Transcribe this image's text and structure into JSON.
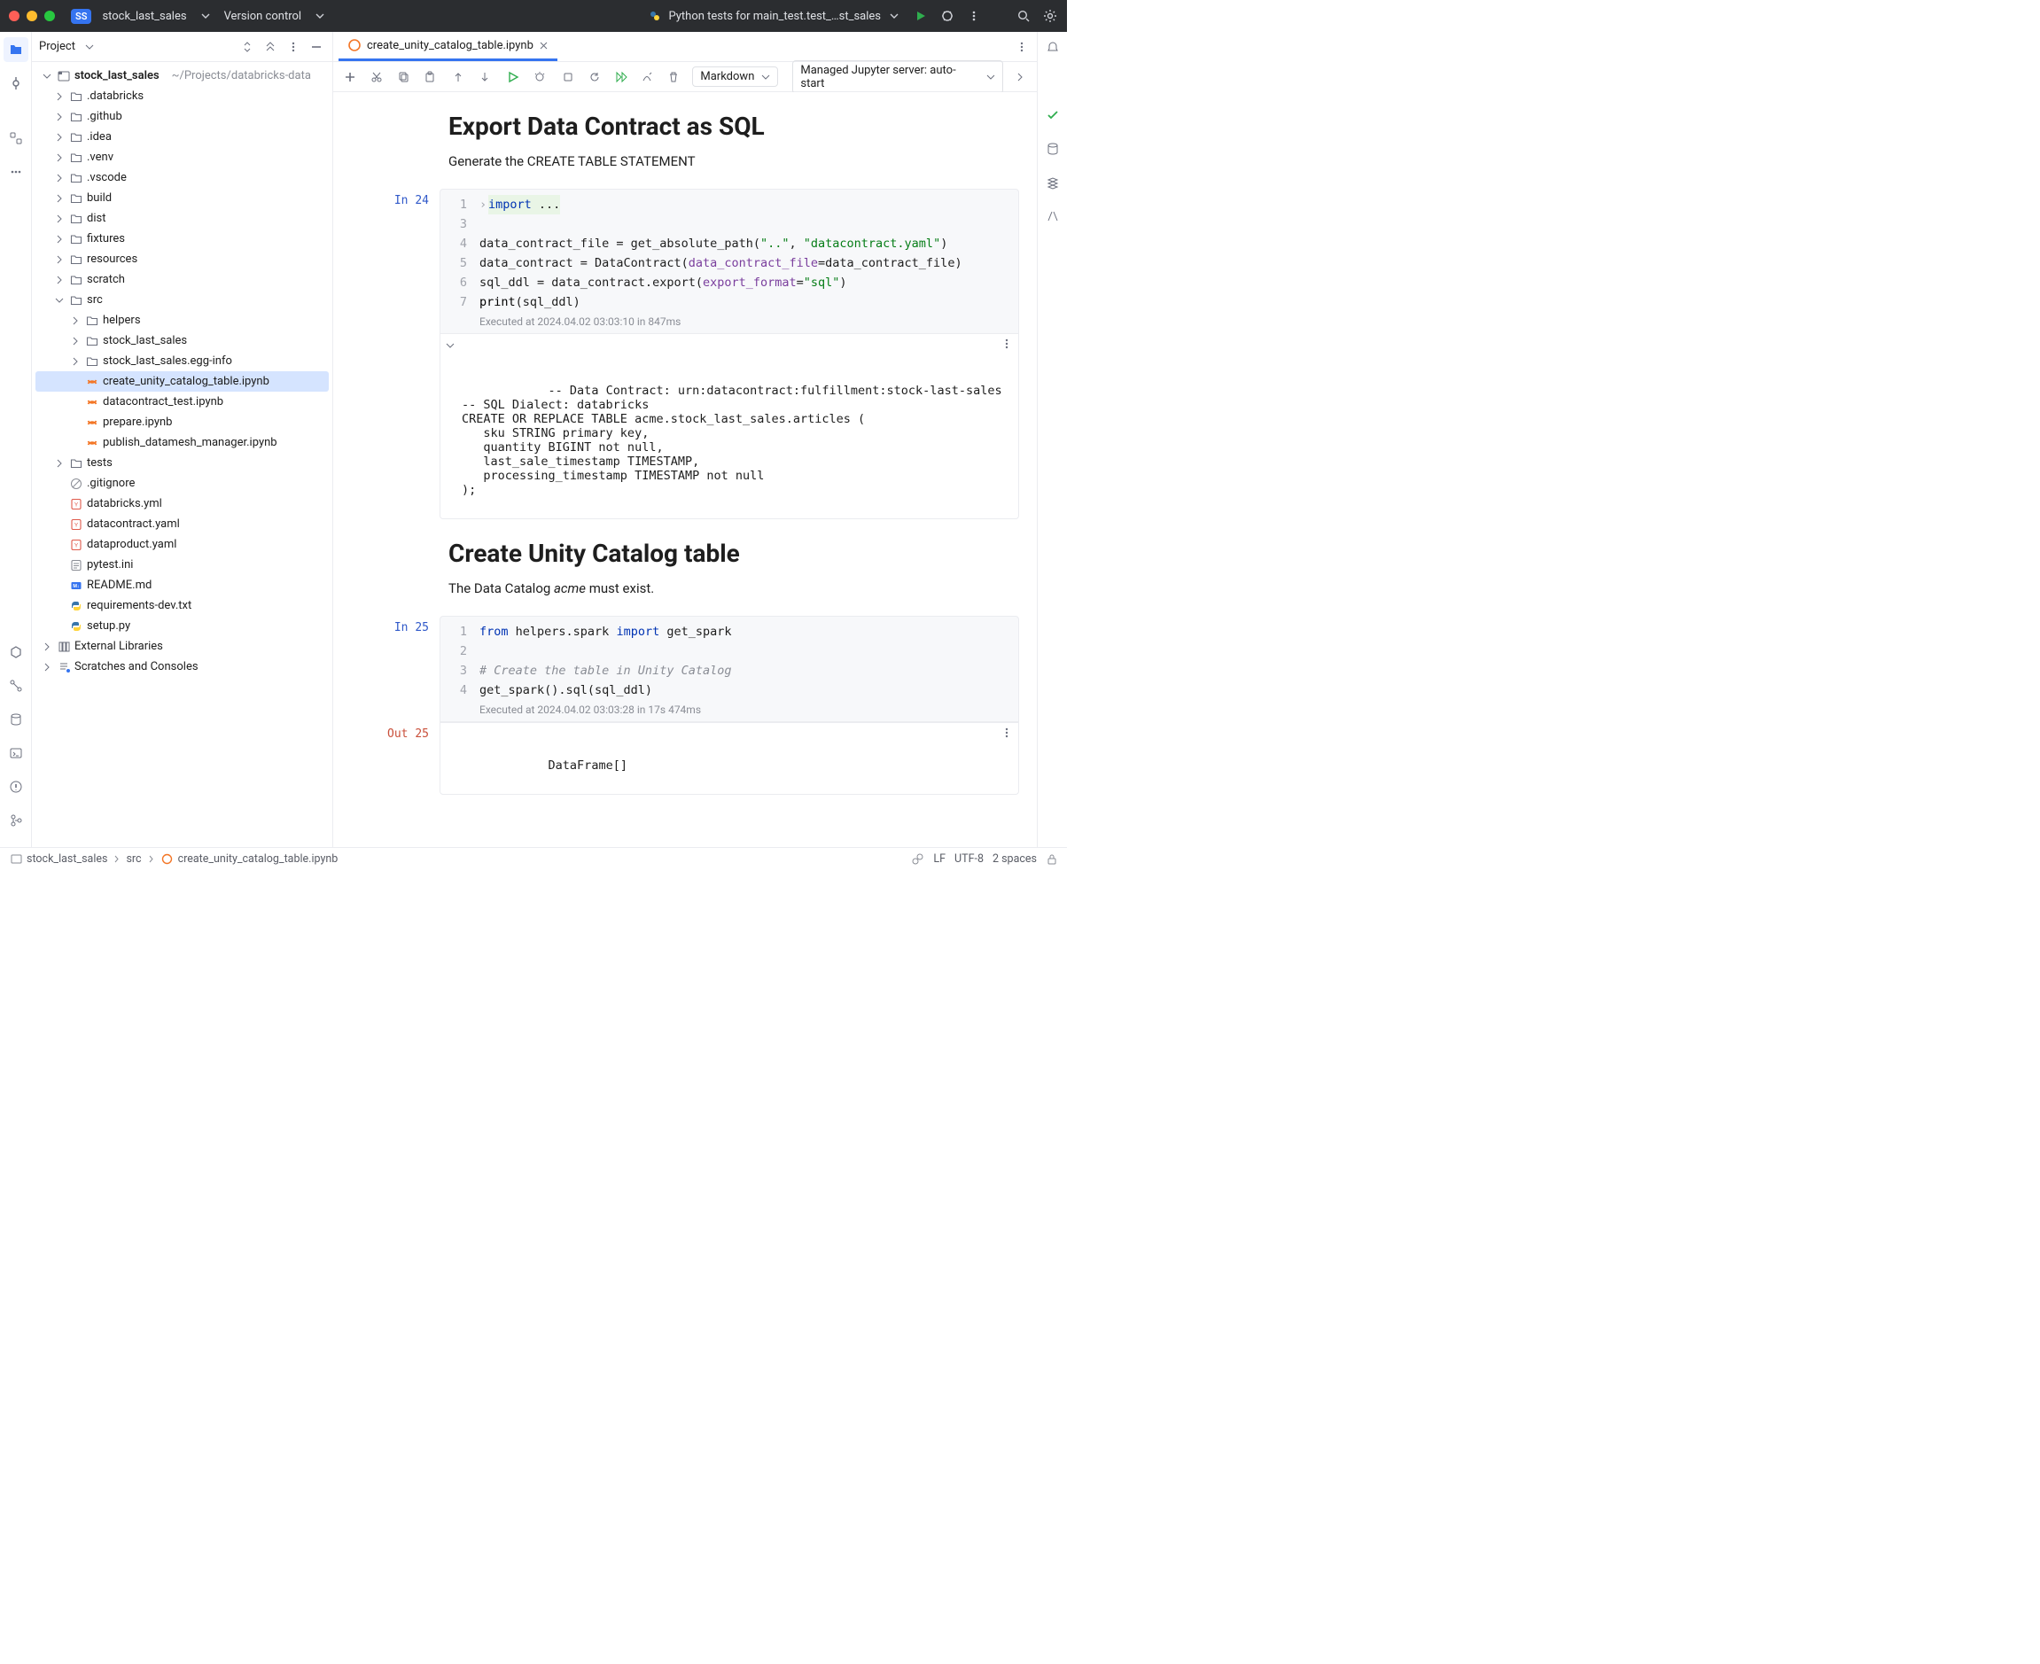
{
  "titlebar": {
    "project_badge": "SS",
    "project_name": "stock_last_sales",
    "version_control": "Version control",
    "run_config": "Python tests for main_test.test_…st_sales"
  },
  "project_panel": {
    "title": "Project"
  },
  "tree": {
    "root_name": "stock_last_sales",
    "root_path": "~/Projects/databricks-data",
    "items": [
      {
        "depth": 0,
        "chev": "right",
        "icon": "folder",
        "label": ".databricks"
      },
      {
        "depth": 0,
        "chev": "right",
        "icon": "folder",
        "label": ".github"
      },
      {
        "depth": 0,
        "chev": "right",
        "icon": "folder",
        "label": ".idea"
      },
      {
        "depth": 0,
        "chev": "right",
        "icon": "folder",
        "label": ".venv"
      },
      {
        "depth": 0,
        "chev": "right",
        "icon": "folder",
        "label": ".vscode"
      },
      {
        "depth": 0,
        "chev": "right",
        "icon": "folder",
        "label": "build"
      },
      {
        "depth": 0,
        "chev": "right",
        "icon": "folder",
        "label": "dist"
      },
      {
        "depth": 0,
        "chev": "right",
        "icon": "folder",
        "label": "fixtures"
      },
      {
        "depth": 0,
        "chev": "right",
        "icon": "folder",
        "label": "resources"
      },
      {
        "depth": 0,
        "chev": "right",
        "icon": "folder",
        "label": "scratch"
      },
      {
        "depth": 0,
        "chev": "down",
        "icon": "folder",
        "label": "src"
      },
      {
        "depth": 1,
        "chev": "right",
        "icon": "folder",
        "label": "helpers"
      },
      {
        "depth": 1,
        "chev": "right",
        "icon": "folder",
        "label": "stock_last_sales"
      },
      {
        "depth": 1,
        "chev": "right",
        "icon": "folder",
        "label": "stock_last_sales.egg-info"
      },
      {
        "depth": 1,
        "chev": "",
        "icon": "jupyter",
        "label": "create_unity_catalog_table.ipynb",
        "selected": true
      },
      {
        "depth": 1,
        "chev": "",
        "icon": "jupyter",
        "label": "datacontract_test.ipynb"
      },
      {
        "depth": 1,
        "chev": "",
        "icon": "jupyter",
        "label": "prepare.ipynb"
      },
      {
        "depth": 1,
        "chev": "",
        "icon": "jupyter",
        "label": "publish_datamesh_manager.ipynb"
      },
      {
        "depth": 0,
        "chev": "right",
        "icon": "folder",
        "label": "tests"
      },
      {
        "depth": 0,
        "chev": "",
        "icon": "gitignore",
        "label": ".gitignore"
      },
      {
        "depth": 0,
        "chev": "",
        "icon": "yaml",
        "label": "databricks.yml"
      },
      {
        "depth": 0,
        "chev": "",
        "icon": "yaml",
        "label": "datacontract.yaml"
      },
      {
        "depth": 0,
        "chev": "",
        "icon": "yaml",
        "label": "dataproduct.yaml"
      },
      {
        "depth": 0,
        "chev": "",
        "icon": "ini",
        "label": "pytest.ini"
      },
      {
        "depth": 0,
        "chev": "",
        "icon": "md",
        "label": "README.md"
      },
      {
        "depth": 0,
        "chev": "",
        "icon": "py",
        "label": "requirements-dev.txt"
      },
      {
        "depth": 0,
        "chev": "",
        "icon": "py",
        "label": "setup.py"
      }
    ],
    "external": "External Libraries",
    "scratches": "Scratches and Consoles"
  },
  "tabs": {
    "active": "create_unity_catalog_table.ipynb"
  },
  "nb_toolbar": {
    "dropdown": "Markdown",
    "kernel": "Managed Jupyter server: auto-start"
  },
  "notebook": {
    "md1": {
      "heading": "Export Data Contract as SQL",
      "body": "Generate the CREATE TABLE STATEMENT"
    },
    "cell1": {
      "prompt": "In 24",
      "lines": {
        "1_kw": "import",
        "1_rest": " ...",
        "4_pre": "data_contract_file = get_absolute_path(",
        "4_s1": "\"..\"",
        "4_mid": ", ",
        "4_s2": "\"datacontract.yaml\"",
        "4_post": ")",
        "5_pre": "data_contract = DataContract(",
        "5_kw": "data_contract_file",
        "5_post": "=data_contract_file)",
        "6_pre": "sql_ddl = data_contract.export(",
        "6_kw": "export_format",
        "6_eq": "=",
        "6_s": "\"sql\"",
        "6_post": ")",
        "7_fn": "print",
        "7_post": "(sql_ddl)"
      },
      "exec": "Executed at 2024.04.02 03:03:10 in 847ms",
      "output": "-- Data Contract: urn:datacontract:fulfillment:stock-last-sales\n-- SQL Dialect: databricks\nCREATE OR REPLACE TABLE acme.stock_last_sales.articles (\n   sku STRING primary key,\n   quantity BIGINT not null,\n   last_sale_timestamp TIMESTAMP,\n   processing_timestamp TIMESTAMP not null\n);"
    },
    "md2": {
      "heading": "Create Unity Catalog table",
      "body_pre": "The Data Catalog ",
      "body_em": "acme",
      "body_post": " must exist."
    },
    "cell2": {
      "prompt": "In 25",
      "lines": {
        "1_kw1": "from",
        "1_mid": " helpers.spark ",
        "1_kw2": "import",
        "1_post": " get_spark",
        "3_comment": "# Create the table in Unity Catalog",
        "4": "get_spark().sql(sql_ddl)"
      },
      "exec": "Executed at 2024.04.02 03:03:28 in 17s 474ms"
    },
    "out2": {
      "prompt": "Out 25",
      "text": "DataFrame[]"
    }
  },
  "breadcrumb": {
    "a": "stock_last_sales",
    "b": "src",
    "c": "create_unity_catalog_table.ipynb"
  },
  "statusbar": {
    "eol": "LF",
    "encoding": "UTF-8",
    "indent": "2 spaces"
  }
}
